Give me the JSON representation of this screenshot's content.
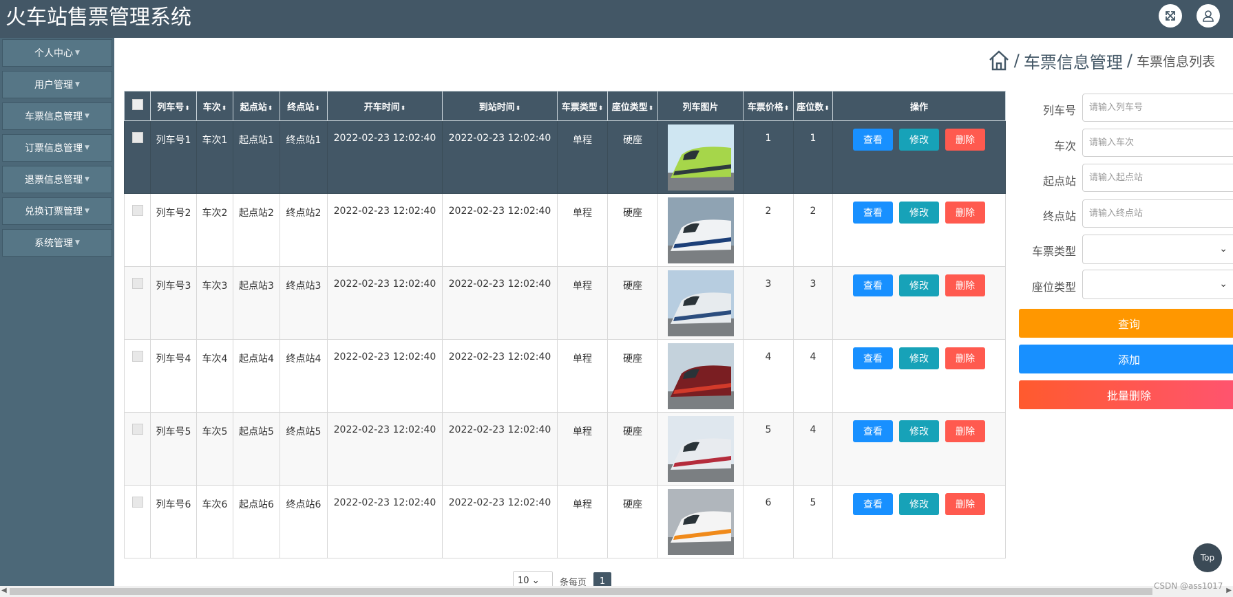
{
  "app": {
    "title": "火车站售票管理系统"
  },
  "header": {
    "fullscreen_icon": "expand-icon",
    "user_icon": "user-icon"
  },
  "sidebar": {
    "items": [
      {
        "label": "个人中心"
      },
      {
        "label": "用户管理"
      },
      {
        "label": "车票信息管理"
      },
      {
        "label": "订票信息管理"
      },
      {
        "label": "退票信息管理"
      },
      {
        "label": "兑换订票管理"
      },
      {
        "label": "系统管理"
      }
    ]
  },
  "breadcrumb": {
    "icon": "home-icon",
    "sep": "/",
    "main": "车票信息管理",
    "sub": "车票信息列表"
  },
  "table": {
    "headers": [
      "列车号",
      "车次",
      "起点站",
      "终点站",
      "开车时间",
      "到站时间",
      "车票类型",
      "座位类型",
      "列车图片",
      "车票价格",
      "座位数",
      "操作"
    ],
    "actions": {
      "view": "查看",
      "edit": "修改",
      "delete": "删除"
    },
    "rows": [
      {
        "train_no": "列车号1",
        "trip": "车次1",
        "from": "起点站1",
        "to": "终点站1",
        "depart": "2022-02-23 12:02:40",
        "arrive": "2022-02-23 12:02:40",
        "ticket_type": "单程",
        "seat_type": "硬座",
        "price": "1",
        "seats": "1"
      },
      {
        "train_no": "列车号2",
        "trip": "车次2",
        "from": "起点站2",
        "to": "终点站2",
        "depart": "2022-02-23 12:02:40",
        "arrive": "2022-02-23 12:02:40",
        "ticket_type": "单程",
        "seat_type": "硬座",
        "price": "2",
        "seats": "2"
      },
      {
        "train_no": "列车号3",
        "trip": "车次3",
        "from": "起点站3",
        "to": "终点站3",
        "depart": "2022-02-23 12:02:40",
        "arrive": "2022-02-23 12:02:40",
        "ticket_type": "单程",
        "seat_type": "硬座",
        "price": "3",
        "seats": "3"
      },
      {
        "train_no": "列车号4",
        "trip": "车次4",
        "from": "起点站4",
        "to": "终点站4",
        "depart": "2022-02-23 12:02:40",
        "arrive": "2022-02-23 12:02:40",
        "ticket_type": "单程",
        "seat_type": "硬座",
        "price": "4",
        "seats": "4"
      },
      {
        "train_no": "列车号5",
        "trip": "车次5",
        "from": "起点站5",
        "to": "终点站5",
        "depart": "2022-02-23 12:02:40",
        "arrive": "2022-02-23 12:02:40",
        "ticket_type": "单程",
        "seat_type": "硬座",
        "price": "5",
        "seats": "4"
      },
      {
        "train_no": "列车号6",
        "trip": "车次6",
        "from": "起点站6",
        "to": "终点站6",
        "depart": "2022-02-23 12:02:40",
        "arrive": "2022-02-23 12:02:40",
        "ticket_type": "单程",
        "seat_type": "硬座",
        "price": "6",
        "seats": "5"
      }
    ]
  },
  "search": {
    "fields": [
      {
        "label": "列车号",
        "placeholder": "请输入列车号"
      },
      {
        "label": "车次",
        "placeholder": "请输入车次"
      },
      {
        "label": "起点站",
        "placeholder": "请输入起点站"
      },
      {
        "label": "终点站",
        "placeholder": "请输入终点站"
      }
    ],
    "selects": [
      {
        "label": "车票类型",
        "value": ""
      },
      {
        "label": "座位类型",
        "value": ""
      }
    ],
    "query": "查询",
    "add": "添加",
    "batch_delete": "批量删除"
  },
  "pager": {
    "page_size": "10",
    "per_page_label": "条每页",
    "current": "1"
  },
  "top_button": "Top",
  "watermark": "CSDN @ass1017",
  "colors": {
    "header": "#435766",
    "sidebar": "#4c6878",
    "view": "#1890ff",
    "edit": "#17a2b8",
    "delete": "#ff5a4f",
    "query": "#ff9700"
  }
}
